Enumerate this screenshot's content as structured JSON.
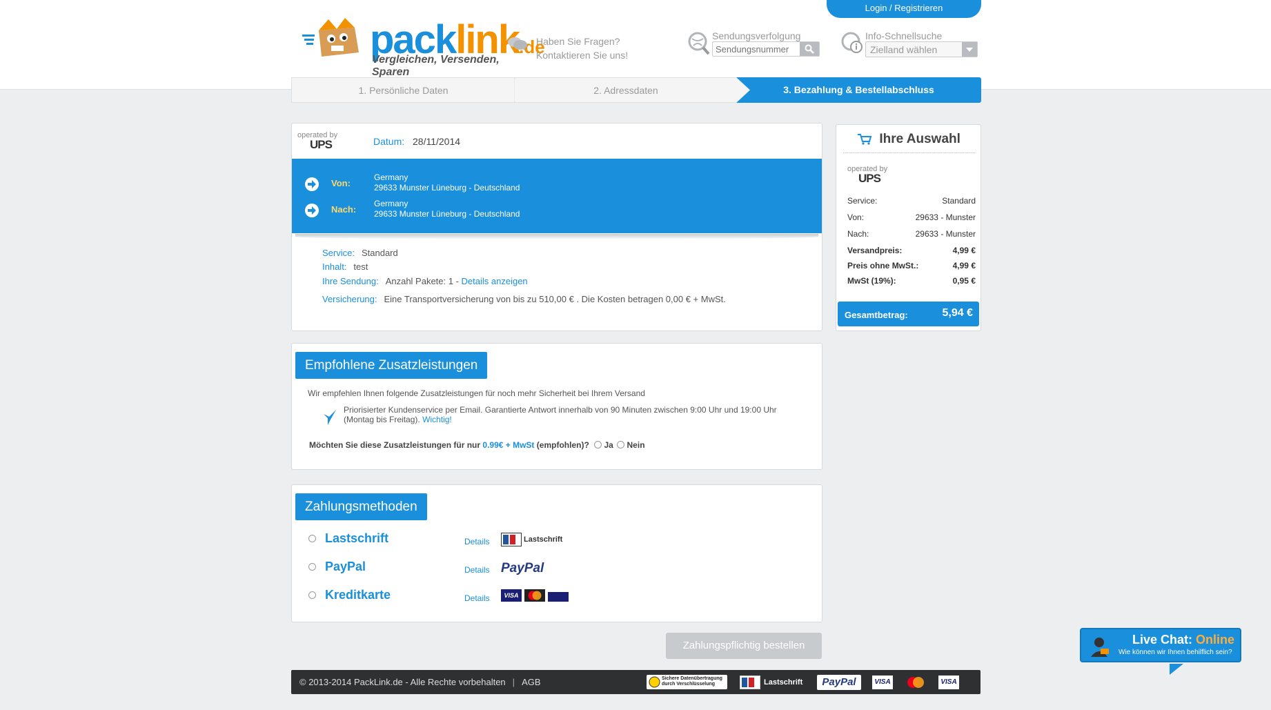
{
  "header": {
    "login_label": "Login / Registrieren",
    "logo_text_a": "pack",
    "logo_text_b": "link",
    "logo_tld": ".de",
    "tagline": "Vergleichen, Versenden, Sparen",
    "contact_line1": "Haben Sie Fragen?",
    "contact_line2": "Kontaktieren Sie uns!",
    "tracking_label": "Sendungsverfolgung",
    "tracking_placeholder": "Sendungsnummer",
    "info_label": "Info-Schnellsuche",
    "info_select_value": "Zielland wählen"
  },
  "steps": [
    {
      "label": "1. Persönliche Daten",
      "active": false
    },
    {
      "label": "2. Adressdaten",
      "active": false
    },
    {
      "label": "3. Bezahlung & Bestellabschluss",
      "active": true
    }
  ],
  "shipment": {
    "operated_by": "operated by",
    "carrier": "UPS",
    "date_label": "Datum:",
    "date_value": "28/11/2014",
    "from_label": "Von:",
    "from_country": "Germany",
    "from_address": "29633 Munster Lüneburg - Deutschland",
    "to_label": "Nach:",
    "to_country": "Germany",
    "to_address": "29633 Munster Lüneburg - Deutschland",
    "service_label": "Service:",
    "service_value": "Standard",
    "content_label": "Inhalt:",
    "content_value": "test",
    "parcel_label": "Ihre Sendung:",
    "parcel_value": "Anzahl Pakete: 1 -",
    "parcel_link": "Details anzeigen",
    "insurance_label": "Versicherung:",
    "insurance_value": "Eine Transportversicherung von bis zu 510,00 € . Die Kosten betragen 0,00 € + MwSt."
  },
  "extras": {
    "title": "Empfohlene Zusatzleistungen",
    "intro": "Wir empfehlen Ihnen folgende Zusatzleistungen für noch mehr Sicherheit bei Ihrem Versand",
    "item_text_line1": "Priorisierter Kundenservice per Email. Garantierte Antwort innerhalb von 90 Minuten zwischen 9:00 Uhr und 19:00 Uhr",
    "item_text_line2": "(Montag bis Freitag).",
    "item_link": "Wichtig!",
    "question_a": "Möchten Sie diese Zusatzleistungen für nur",
    "question_price": "0.99€ + MwSt",
    "question_b": "(empfohlen)?",
    "yes_label": "Ja",
    "no_label": "Nein"
  },
  "payment": {
    "title": "Zahlungsmethoden",
    "details_label": "Details",
    "methods": [
      {
        "name": "Lastschrift",
        "logo_text": "Lastschrift"
      },
      {
        "name": "PayPal",
        "logo_text": "PayPal"
      },
      {
        "name": "Kreditkarte",
        "logo_text": "VISA"
      }
    ]
  },
  "order_button": "Zahlungspflichtig bestellen",
  "footer": {
    "copyright": "© 2013-2014 PackLink.de - Alle Rechte vorbehalten",
    "separator": "|",
    "agb": "AGB",
    "ssl_line1": "Sichere Datenübertragung",
    "ssl_line2": "durch Verschlüsselung",
    "lastschrift": "Lastschrift",
    "paypal": "PayPal",
    "visa": "VISA",
    "mastercard": "MasterCard"
  },
  "sidebar": {
    "title": "Ihre Auswahl",
    "operated_by": "operated by",
    "carrier": "UPS",
    "rows": [
      {
        "label": "Service:",
        "value": "Standard"
      },
      {
        "label": "Von:",
        "value": "29633 - Munster"
      },
      {
        "label": "Nach:",
        "value": "29633 - Munster"
      }
    ],
    "bold_rows": [
      {
        "label": "Versandpreis:",
        "value": "4,99 €"
      },
      {
        "label": "Preis ohne MwSt.:",
        "value": "4,99 €"
      },
      {
        "label": "MwSt (19%):",
        "value": "0,95 €"
      }
    ],
    "total_label": "Gesamtbetrag:",
    "total_value": "5,94 €"
  },
  "chat": {
    "title_a": "Live Chat:",
    "title_b": "Online",
    "subtitle": "Wie können wir Ihnen behilflich sein?"
  },
  "colors": {
    "accent": "#1a8fdc",
    "brand_orange": "#f39200",
    "label_yellow": "#ffd76b"
  }
}
